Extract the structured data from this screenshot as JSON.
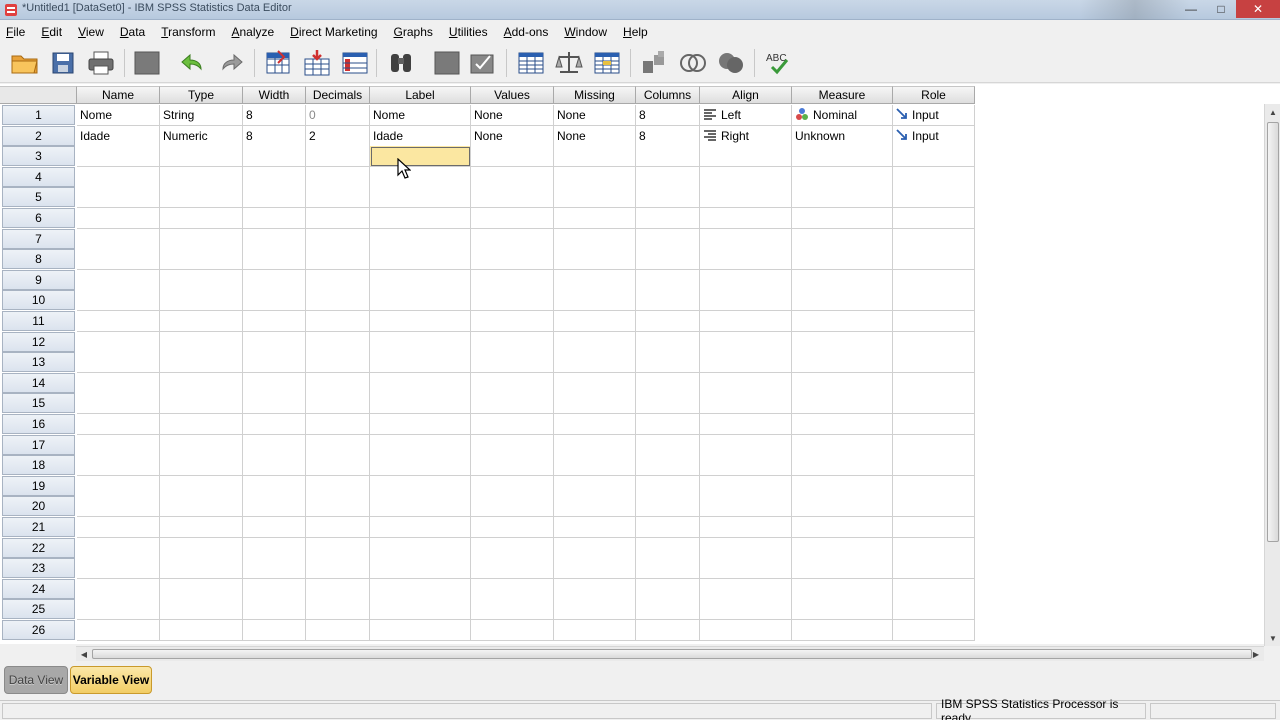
{
  "window": {
    "title": "*Untitled1 [DataSet0] - IBM SPSS Statistics Data Editor",
    "controls": {
      "minimize": "—",
      "maximize": "□",
      "close": "✕"
    }
  },
  "menu": [
    "File",
    "Edit",
    "View",
    "Data",
    "Transform",
    "Analyze",
    "Direct Marketing",
    "Graphs",
    "Utilities",
    "Add-ons",
    "Window",
    "Help"
  ],
  "toolbar": {
    "icons": [
      "open-folder-icon",
      "save-icon",
      "print-icon",
      "dialog-recall-icon",
      "undo-icon",
      "redo-icon",
      "goto-case-icon",
      "goto-variable-icon",
      "variables-icon",
      "find-icon",
      "insert-cases-icon",
      "insert-variable-icon",
      "split-file-icon",
      "weight-cases-icon",
      "select-cases-icon",
      "value-labels-icon",
      "use-variable-sets-icon",
      "show-all-variables-icon",
      "spell-check-icon"
    ]
  },
  "grid": {
    "columns": [
      "Name",
      "Type",
      "Width",
      "Decimals",
      "Label",
      "Values",
      "Missing",
      "Columns",
      "Align",
      "Measure",
      "Role"
    ],
    "rows": [
      {
        "num": "1",
        "cells": [
          "Nome",
          "String",
          "8",
          "0",
          "Nome",
          "None",
          "None",
          "8",
          "Left",
          "Nominal",
          "Input"
        ],
        "align_icon": "align-left-icon",
        "measure_icon": "nominal-icon",
        "role_icon": "input-role-icon"
      },
      {
        "num": "2",
        "cells": [
          "Idade",
          "Numeric",
          "8",
          "2",
          "Idade",
          "None",
          "None",
          "8",
          "Right",
          "Unknown",
          "Input"
        ],
        "align_icon": "align-right-icon",
        "measure_icon": "",
        "role_icon": "input-role-icon"
      }
    ],
    "empty_row_numbers": [
      "3",
      "4",
      "5",
      "6",
      "7",
      "8",
      "9",
      "10",
      "11",
      "12",
      "13",
      "14",
      "15",
      "16",
      "17",
      "18",
      "19",
      "20",
      "21",
      "22",
      "23",
      "24",
      "25",
      "26"
    ],
    "selected_cell": {
      "row": "3",
      "column": "Label"
    }
  },
  "tabs": {
    "data_view": "Data View",
    "variable_view": "Variable View",
    "active": "Variable View"
  },
  "status": {
    "processor": "IBM SPSS Statistics Processor is ready"
  },
  "colors": {
    "selected_cell": "#fbe7a1",
    "active_tab": "#f2cd64",
    "row_header": "#dbe3ee"
  }
}
